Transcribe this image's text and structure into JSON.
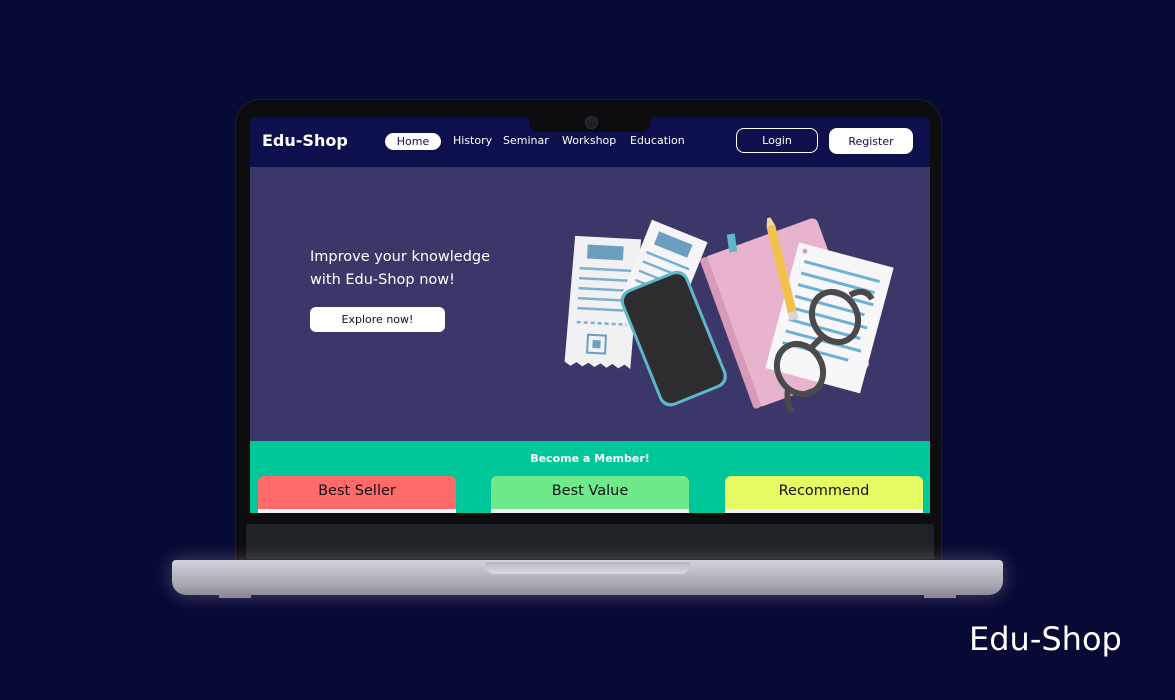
{
  "nav": {
    "brand": "Edu-Shop",
    "links": [
      "Home",
      "History",
      "Seminar",
      "Workshop",
      "Education"
    ],
    "active": "Home",
    "login": "Login",
    "register": "Register"
  },
  "hero": {
    "line1": "Improve your knowledge",
    "line2": "with Edu-Shop now!",
    "cta": "Explore now!"
  },
  "member": {
    "title": "Become a Member!",
    "plans": [
      {
        "label": "Best Seller",
        "color": "#ff6b6b"
      },
      {
        "label": "Best Value",
        "color": "#6eea8c"
      },
      {
        "label": "Recommend",
        "color": "#e6fa62"
      }
    ]
  },
  "tagline": "Edu-Shop",
  "colors": {
    "background": "#080a36",
    "nav": "#0e0f4d",
    "hero": "#3c3769",
    "member_band": "#00c79a"
  }
}
